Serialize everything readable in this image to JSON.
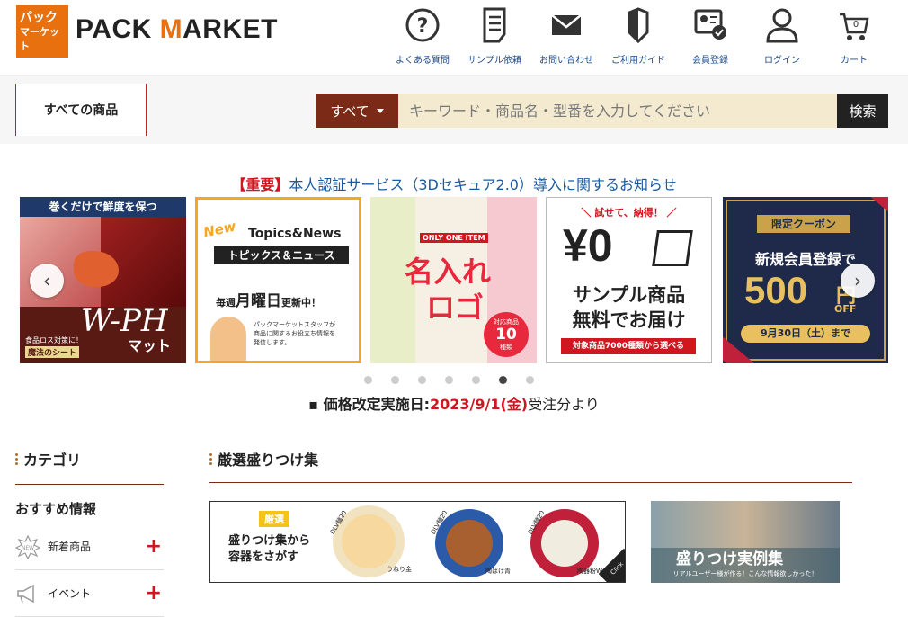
{
  "brand": {
    "logo_line1": "パック",
    "logo_line2": "マーケット",
    "name_part1": "PACK ",
    "name_part2": "M",
    "name_part3": "ARKET"
  },
  "topnav": [
    {
      "label": "よくある質問",
      "icon": "question-icon"
    },
    {
      "label": "サンプル依頼",
      "icon": "document-icon"
    },
    {
      "label": "お問い合わせ",
      "icon": "mail-icon"
    },
    {
      "label": "ご利用ガイド",
      "icon": "guide-icon"
    },
    {
      "label": "会員登録",
      "icon": "member-card-icon"
    },
    {
      "label": "ログイン",
      "icon": "user-icon"
    },
    {
      "label": "カート",
      "icon": "cart-icon",
      "count": "0"
    }
  ],
  "search": {
    "all_products": "すべての商品",
    "scope": "すべて",
    "placeholder": "キーワード・商品名・型番を入力してください",
    "button": "検索"
  },
  "notice": {
    "tag": "【重要】",
    "text": "本人認証サービス（3Dセキュア2.0）導入に関するお知らせ"
  },
  "slides": {
    "s1": {
      "top": "巻くだけで鮮度を保つ",
      "title": "W-PH",
      "sub": "マット",
      "small1": "食品ロス対策に！",
      "small2": "魔法のシート"
    },
    "s2": {
      "new": "New",
      "title": "Topics&News",
      "jp": "トピックス＆ニュース",
      "weekly_1": "毎週",
      "weekly_2": "月曜日",
      "weekly_3": "更新中！",
      "desc1": "パックマーケットスタッフが",
      "desc2": "商品に関するお役立ち情報を",
      "desc3": "発信します。"
    },
    "s3": {
      "tag": "ONLY ONE ITEM",
      "l1": "名入れ",
      "l2": "ロゴ",
      "badge_top": "対応商品",
      "badge_num": "10",
      "badge_unit": "種類"
    },
    "s4": {
      "top": "＼ 試せて、納得！ ／",
      "big": "¥0",
      "l1": "サンプル商品",
      "l2": "無料でお届け",
      "bar": "対象商品7000種類から選べる"
    },
    "s5": {
      "tag": "限定クーポン",
      "l1": "新規会員登録で",
      "amount": "500",
      "unit": "円",
      "off": "OFF",
      "date": "9月30日（土）まで"
    }
  },
  "carousel": {
    "total": 7,
    "active": 5
  },
  "price": {
    "prefix": "価格改定実施日:",
    "date": "2023/9/1(金)",
    "suffix": "受注分より"
  },
  "sidebar": {
    "category_title": "カテゴリ",
    "rec_title": "おすすめ情報",
    "items": [
      {
        "label": "新着商品"
      },
      {
        "label": "イベント"
      }
    ]
  },
  "main": {
    "section_title": "厳選盛りつけ集"
  },
  "banner1": {
    "tag": "厳選",
    "l1": "盛りつけ集から",
    "l2": "容器をさがす",
    "c1": "DLV麺20",
    "c2": "DLV麺20",
    "c3": "DLV麺20",
    "n1": "うねり金",
    "n2": "陶はけ青",
    "n3": "陶器粉W",
    "click": "Click"
  },
  "banner2": {
    "title": "盛りつけ実例集",
    "sub": "リアルユーザー様が作る！こんな情報欲しかった！"
  },
  "colors": {
    "brand_orange": "#e8700f",
    "dark_red": "#7b2a17",
    "link_blue": "#1a5aa0",
    "alert_red": "#d0171f"
  }
}
